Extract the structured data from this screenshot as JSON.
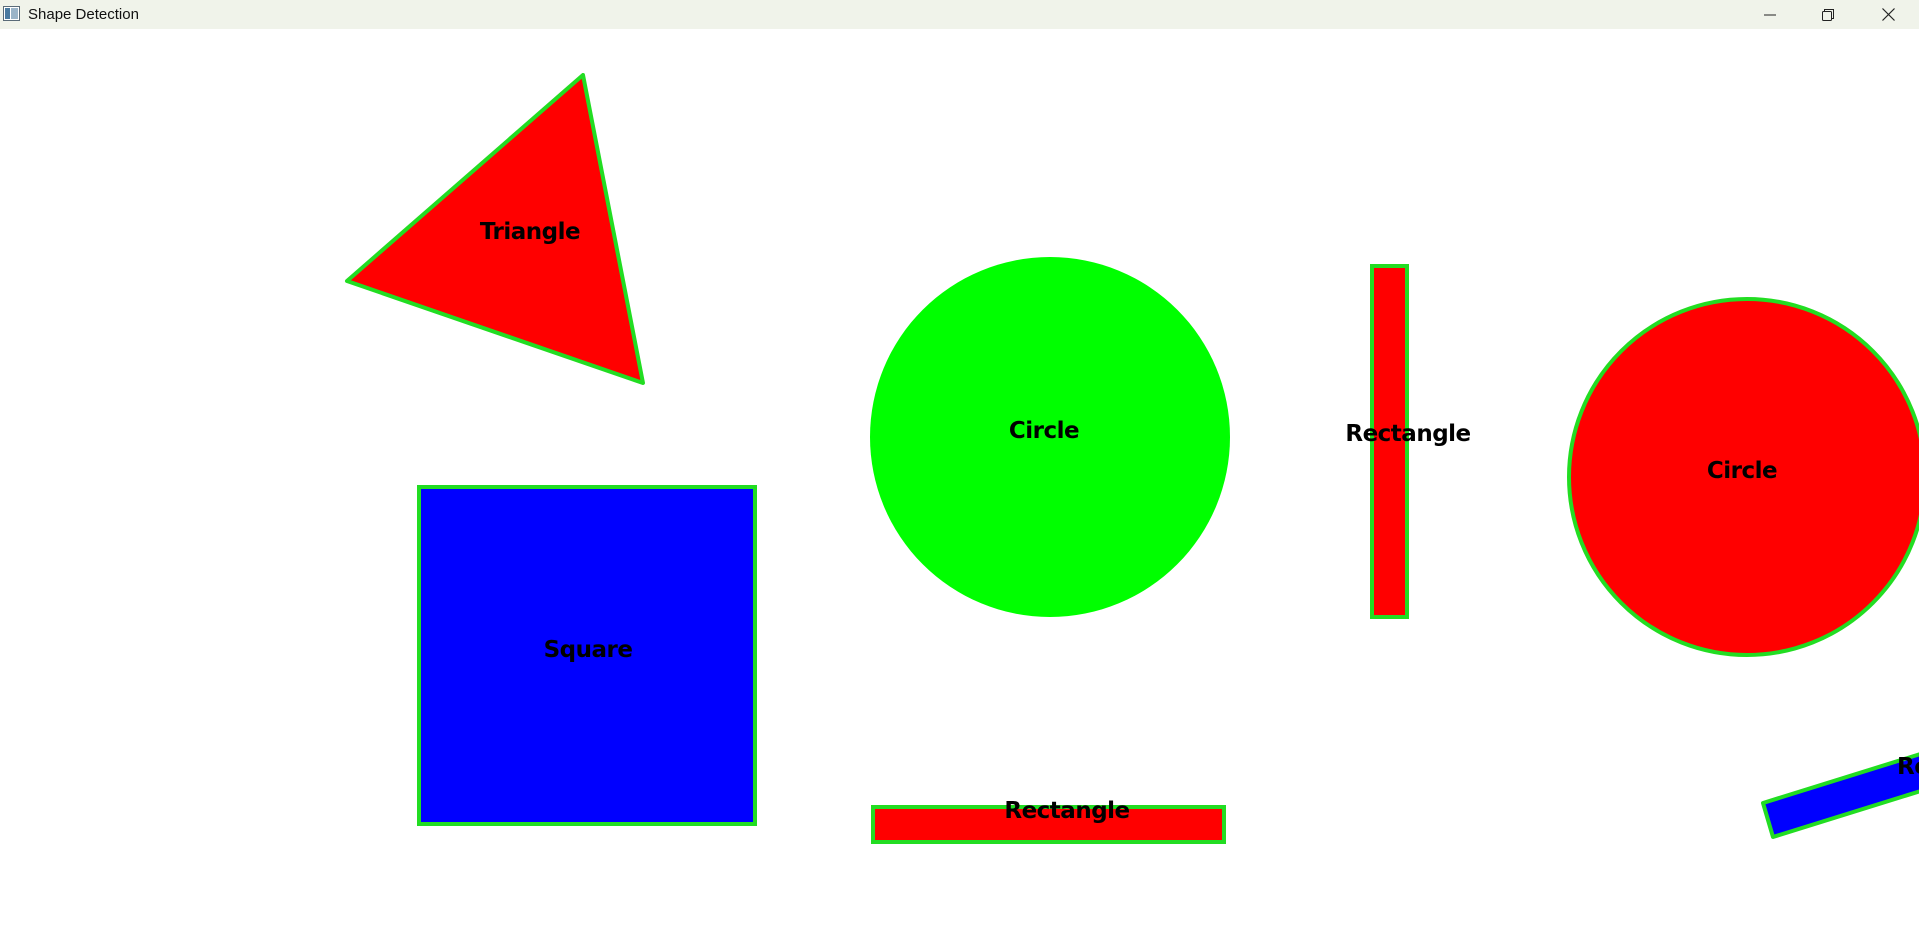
{
  "window": {
    "title": "Shape Detection",
    "icons": {
      "app": "app-window-icon",
      "minimize": "minimize-icon",
      "maximize": "restore-icon",
      "close": "close-icon"
    }
  },
  "colors": {
    "red": "#ff0000",
    "green": "#00ff00",
    "blue": "#0000ff",
    "contour": "#22dd22",
    "label": "#000000",
    "background": "#ffffff"
  },
  "shapes": [
    {
      "label": "Triangle"
    },
    {
      "label": "Circle"
    },
    {
      "label": "Rectangle"
    },
    {
      "label": "Circle"
    },
    {
      "label": "Square"
    },
    {
      "label": "Rectangle"
    },
    {
      "label": "Re"
    }
  ]
}
